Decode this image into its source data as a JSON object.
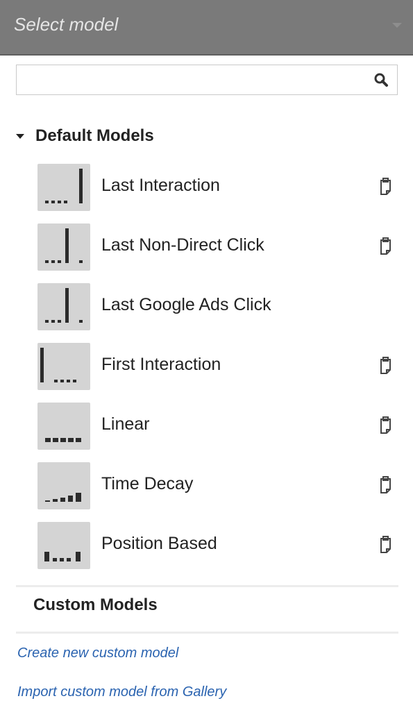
{
  "header": {
    "title": "Select model"
  },
  "search": {
    "value": "",
    "placeholder": "",
    "icon": "search-icon"
  },
  "default_models": {
    "label": "Default Models",
    "items": [
      {
        "label": "Last Interaction",
        "thumb": "last-interaction",
        "copyable": true,
        "copy_icon": "copy-icon"
      },
      {
        "label": "Last Non-Direct Click",
        "thumb": "last-non-direct-click",
        "copyable": true,
        "copy_icon": "copy-icon"
      },
      {
        "label": "Last Google Ads Click",
        "thumb": "last-google-ads-click",
        "copyable": false
      },
      {
        "label": "First Interaction",
        "thumb": "first-interaction",
        "copyable": true,
        "copy_icon": "copy-icon"
      },
      {
        "label": "Linear",
        "thumb": "linear",
        "copyable": true,
        "copy_icon": "copy-icon"
      },
      {
        "label": "Time Decay",
        "thumb": "time-decay",
        "copyable": true,
        "copy_icon": "copy-icon"
      },
      {
        "label": "Position Based",
        "thumb": "position-based",
        "copyable": true,
        "copy_icon": "copy-icon"
      }
    ]
  },
  "custom_models": {
    "label": "Custom Models"
  },
  "links": {
    "create": "Create new custom model",
    "import": "Import custom model from Gallery"
  },
  "colors": {
    "header_bg": "#7a7a7a",
    "header_text": "#e6e6e6",
    "thumb_bg": "#d4d4d4",
    "bar": "#2b2b2b",
    "link": "#2a63b0"
  }
}
